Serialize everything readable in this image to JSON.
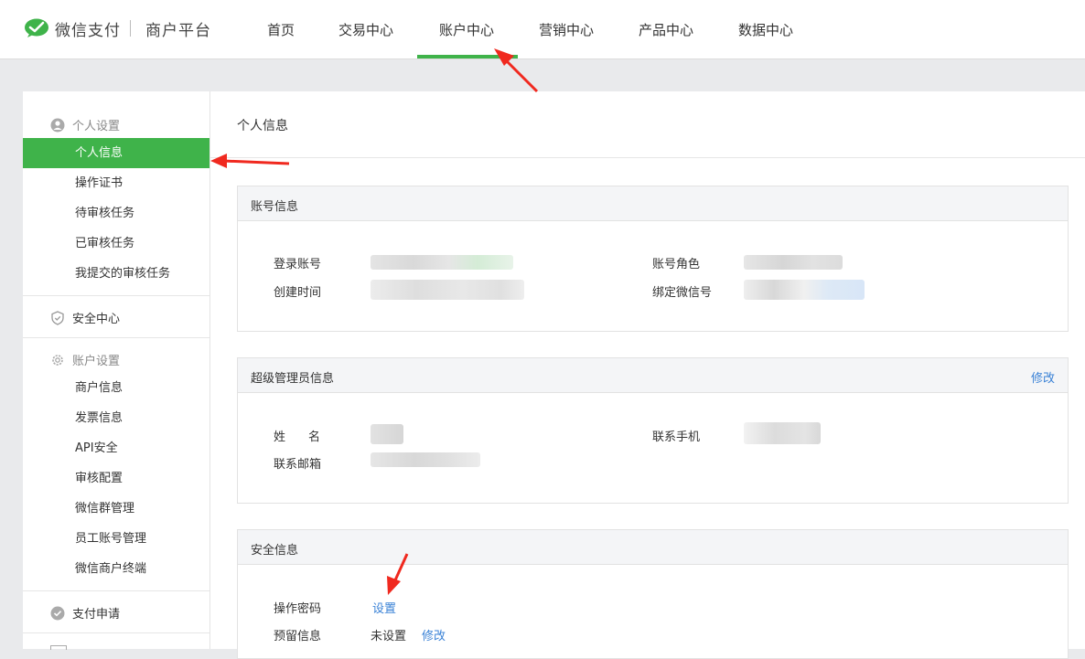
{
  "header": {
    "brand_left": "微信支付",
    "brand_right": "商户平台",
    "nav": [
      {
        "label": "首页"
      },
      {
        "label": "交易中心"
      },
      {
        "label": "账户中心"
      },
      {
        "label": "营销中心"
      },
      {
        "label": "产品中心"
      },
      {
        "label": "数据中心"
      }
    ],
    "active_nav": "账户中心"
  },
  "sidebar": {
    "group_personal": "个人设置",
    "personal_items": [
      "个人信息",
      "操作证书",
      "待审核任务",
      "已审核任务",
      "我提交的审核任务"
    ],
    "security_center": "安全中心",
    "group_account": "账户设置",
    "account_items": [
      "商户信息",
      "发票信息",
      "API安全",
      "审核配置",
      "微信群管理",
      "员工账号管理",
      "微信商户终端"
    ],
    "pay_apply": "支付申请"
  },
  "main": {
    "title": "个人信息",
    "account_info": {
      "title": "账号信息",
      "login_label": "登录账号",
      "created_label": "创建时间",
      "role_label": "账号角色",
      "wechat_label": "绑定微信号"
    },
    "admin_info": {
      "title": "超级管理员信息",
      "edit": "修改",
      "name_label": "姓　名",
      "phone_label": "联系手机",
      "email_label": "联系邮箱"
    },
    "security_info": {
      "title": "安全信息",
      "op_pwd_label": "操作密码",
      "op_pwd_action": "设置",
      "reserved_label": "预留信息",
      "reserved_value": "未设置",
      "reserved_action": "修改"
    }
  },
  "colors": {
    "accent_green": "#3fb34a",
    "link_blue": "#3a82d6",
    "annotation_red": "#f0291f"
  }
}
